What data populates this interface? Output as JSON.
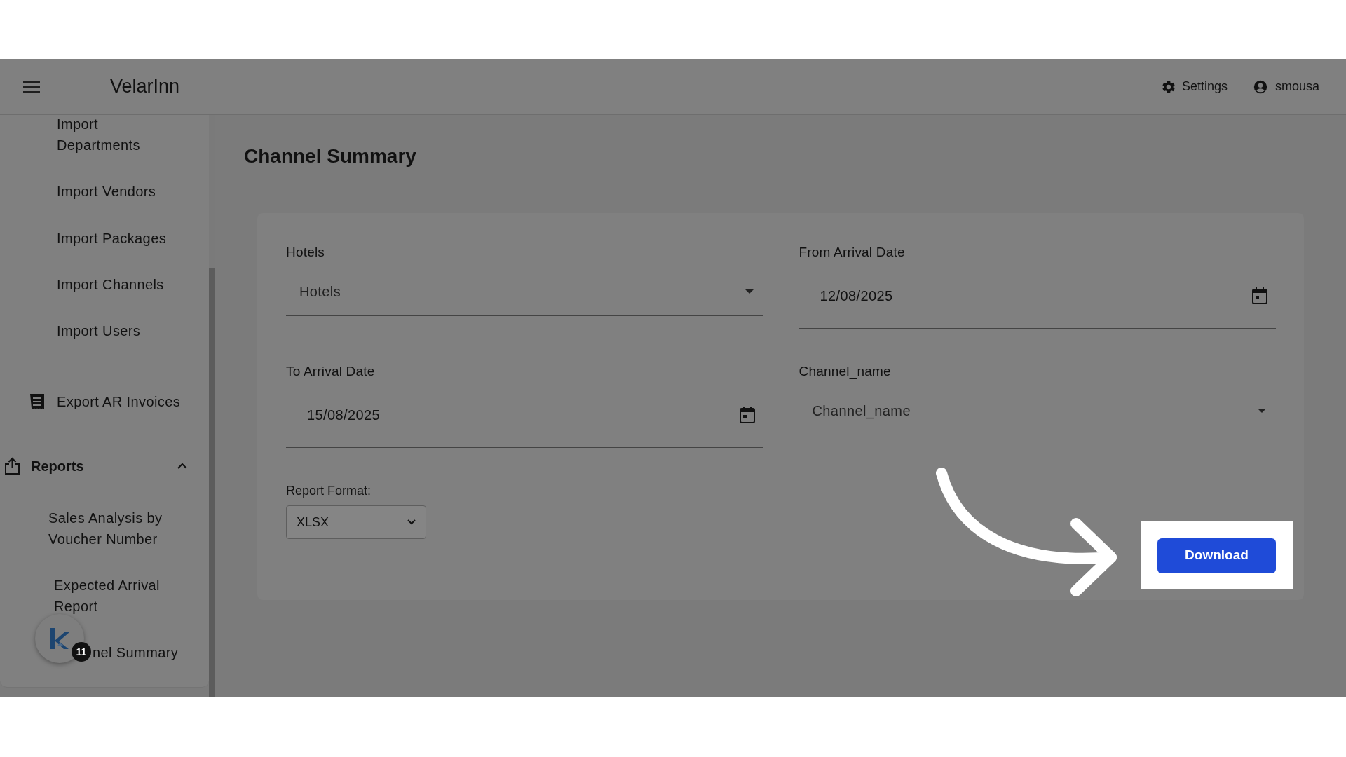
{
  "app": {
    "title": "VelarInn"
  },
  "header": {
    "settings": "Settings",
    "user": "smousa"
  },
  "sidebar": {
    "items": [
      {
        "kind": "sub",
        "label": "Import Departments"
      },
      {
        "kind": "sub",
        "label": "Import Vendors"
      },
      {
        "kind": "sub",
        "label": "Import Packages"
      },
      {
        "kind": "sub",
        "label": "Import Channels"
      },
      {
        "kind": "sub",
        "label": "Import Users"
      },
      {
        "kind": "icon",
        "label": "Export AR Invoices"
      },
      {
        "kind": "section",
        "label": "Reports",
        "expanded": true
      },
      {
        "kind": "report",
        "label": "Sales Analysis by Voucher Number"
      },
      {
        "kind": "report",
        "label": "Expected Arrival Report"
      },
      {
        "kind": "covered",
        "label": "nel Summary"
      }
    ]
  },
  "floating_badge": {
    "count": "11"
  },
  "page": {
    "title": "Channel Summary",
    "fields": [
      {
        "kind": "select",
        "label": "Hotels",
        "placeholder": "Hotels"
      },
      {
        "kind": "date",
        "label": "From Arrival Date",
        "value": "12/08/2025"
      },
      {
        "kind": "date",
        "label": "To Arrival Date",
        "value": "15/08/2025"
      },
      {
        "kind": "select",
        "label": "Channel_name",
        "placeholder": "Channel_name"
      }
    ],
    "report_format": {
      "label": "Report Format:",
      "value": "XLSX"
    },
    "download": "Download"
  }
}
